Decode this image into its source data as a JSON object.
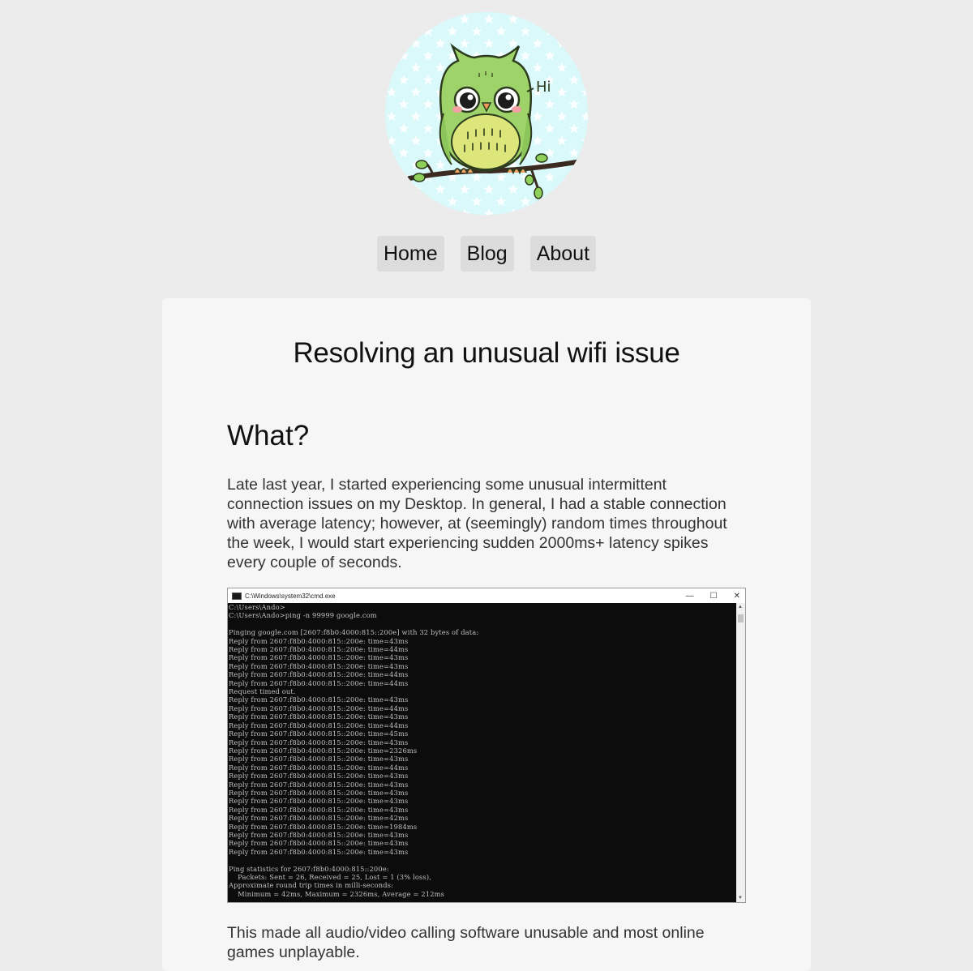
{
  "nav": {
    "home": "Home",
    "blog": "Blog",
    "about": "About"
  },
  "avatar": {
    "greeting": "Hi"
  },
  "post": {
    "title": "Resolving an unusual wifi issue",
    "section_heading": "What?",
    "paragraph_1": "Late last year, I started experiencing some unusual intermittent connection issues on my Desktop. In general, I had a stable connection with average latency; however, at (seemingly) random times throughout the week, I would start experiencing sudden 2000ms+ latency spikes every couple of seconds.",
    "paragraph_2": "This made all audio/video calling software unusable and most online games unplayable."
  },
  "terminal": {
    "title": "C:\\Windows\\system32\\cmd.exe",
    "minimize": "—",
    "maximize": "☐",
    "close": "✕",
    "output": "C:\\Users\\Ando>\nC:\\Users\\Ando>ping -n 99999 google.com\n\nPinging google.com [2607:f8b0:4000:815::200e] with 32 bytes of data:\nReply from 2607:f8b0:4000:815::200e: time=43ms\nReply from 2607:f8b0:4000:815::200e: time=44ms\nReply from 2607:f8b0:4000:815::200e: time=43ms\nReply from 2607:f8b0:4000:815::200e: time=43ms\nReply from 2607:f8b0:4000:815::200e: time=44ms\nReply from 2607:f8b0:4000:815::200e: time=44ms\nRequest timed out.\nReply from 2607:f8b0:4000:815::200e: time=43ms\nReply from 2607:f8b0:4000:815::200e: time=44ms\nReply from 2607:f8b0:4000:815::200e: time=43ms\nReply from 2607:f8b0:4000:815::200e: time=44ms\nReply from 2607:f8b0:4000:815::200e: time=45ms\nReply from 2607:f8b0:4000:815::200e: time=43ms\nReply from 2607:f8b0:4000:815::200e: time=2326ms\nReply from 2607:f8b0:4000:815::200e: time=43ms\nReply from 2607:f8b0:4000:815::200e: time=44ms\nReply from 2607:f8b0:4000:815::200e: time=43ms\nReply from 2607:f8b0:4000:815::200e: time=43ms\nReply from 2607:f8b0:4000:815::200e: time=43ms\nReply from 2607:f8b0:4000:815::200e: time=43ms\nReply from 2607:f8b0:4000:815::200e: time=43ms\nReply from 2607:f8b0:4000:815::200e: time=42ms\nReply from 2607:f8b0:4000:815::200e: time=1984ms\nReply from 2607:f8b0:4000:815::200e: time=43ms\nReply from 2607:f8b0:4000:815::200e: time=43ms\nReply from 2607:f8b0:4000:815::200e: time=43ms\n\nPing statistics for 2607:f8b0:4000:815::200e:\n    Packets: Sent = 26, Received = 25, Lost = 1 (3% loss),\nApproximate round trip times in milli-seconds:\n    Minimum = 42ms, Maximum = 2326ms, Average = 212ms"
  },
  "colors": {
    "page_bg": "#ececec",
    "card_bg": "#f6f6f6",
    "nav_button_bg": "#dcdcdc",
    "avatar_bg": "#d9f9fb",
    "owl_green": "#9ed36a",
    "terminal_bg": "#0c0c0c"
  }
}
